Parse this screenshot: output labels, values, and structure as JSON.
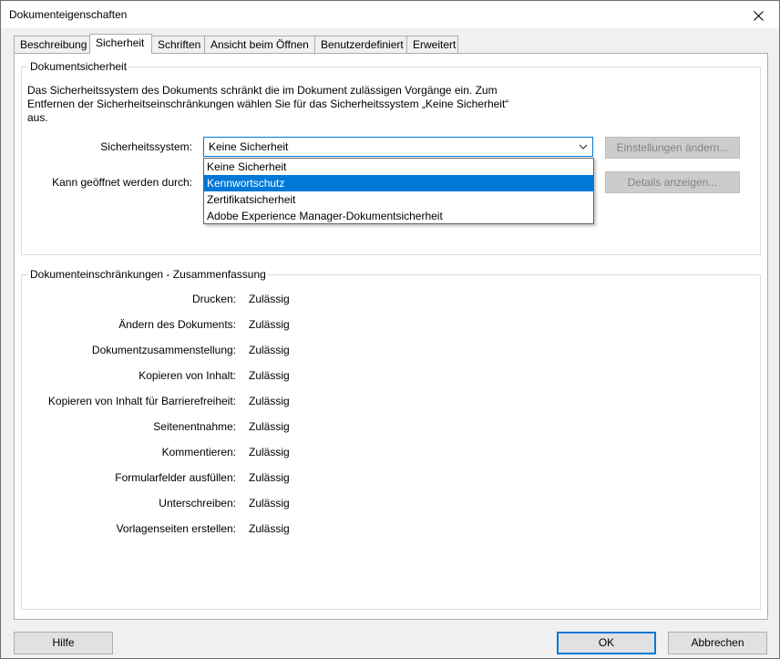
{
  "window": {
    "title": "Dokumenteigenschaften"
  },
  "tabs": [
    {
      "label": "Beschreibung"
    },
    {
      "label": "Sicherheit"
    },
    {
      "label": "Schriften"
    },
    {
      "label": "Ansicht beim Öffnen"
    },
    {
      "label": "Benutzerdefiniert"
    },
    {
      "label": "Erweitert"
    }
  ],
  "security": {
    "group_title": "Dokumentsicherheit",
    "description": "Das Sicherheitssystem des Dokuments schränkt die im Dokument zulässigen Vorgänge ein. Zum Entfernen der Sicherheitseinschränkungen wählen Sie für das Sicherheitssystem „Keine Sicherheit“ aus.",
    "system_label": "Sicherheitssystem:",
    "system_value": "Keine Sicherheit",
    "options": [
      {
        "label": "Keine Sicherheit"
      },
      {
        "label": "Kennwortschutz"
      },
      {
        "label": "Zertifikatsicherheit"
      },
      {
        "label": "Adobe Experience Manager-Dokumentsicherheit"
      }
    ],
    "highlighted_option": "Kennwortschutz",
    "open_label": "Kann geöffnet werden durch:",
    "change_settings": "Einstellungen ändern...",
    "show_details": "Details anzeigen..."
  },
  "restrictions": {
    "group_title": "Dokumenteinschränkungen - Zusammenfassung",
    "rows": [
      {
        "label": "Drucken:",
        "value": "Zulässig"
      },
      {
        "label": "Ändern des Dokuments:",
        "value": "Zulässig"
      },
      {
        "label": "Dokumentzusammenstellung:",
        "value": "Zulässig"
      },
      {
        "label": "Kopieren von Inhalt:",
        "value": "Zulässig"
      },
      {
        "label": "Kopieren von Inhalt für Barrierefreiheit:",
        "value": "Zulässig"
      },
      {
        "label": "Seitenentnahme:",
        "value": "Zulässig"
      },
      {
        "label": "Kommentieren:",
        "value": "Zulässig"
      },
      {
        "label": "Formularfelder ausfüllen:",
        "value": "Zulässig"
      },
      {
        "label": "Unterschreiben:",
        "value": "Zulässig"
      },
      {
        "label": "Vorlagenseiten erstellen:",
        "value": "Zulässig"
      }
    ]
  },
  "buttons": {
    "help": "Hilfe",
    "ok": "OK",
    "cancel": "Abbrechen"
  },
  "icons": {
    "close": "close-icon",
    "dropdown": "chevron-down-icon"
  },
  "colors": {
    "accent": "#0078d7",
    "disabled_button": "#cccccc"
  }
}
